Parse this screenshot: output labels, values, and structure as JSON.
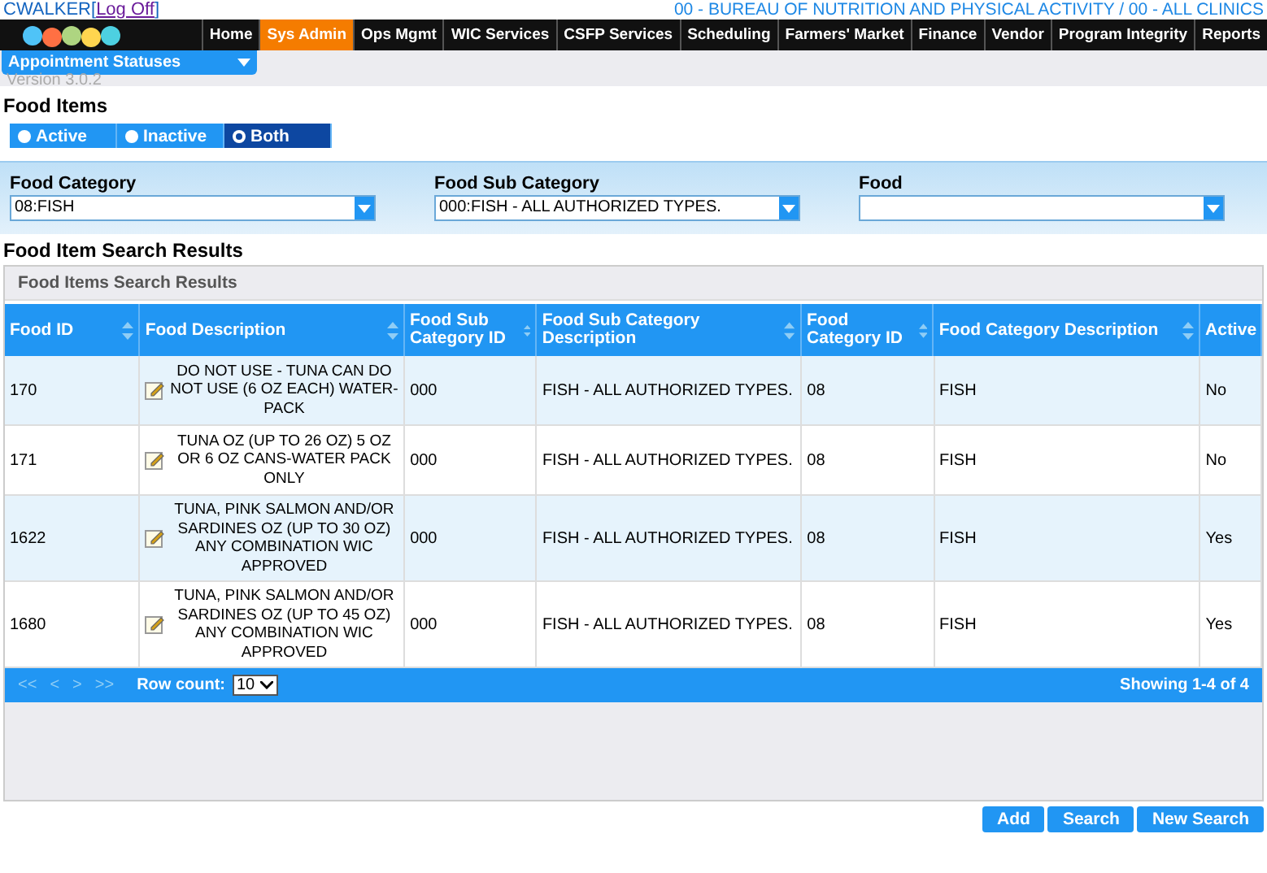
{
  "header": {
    "user": "CWALKER",
    "open_bracket": "[",
    "logoff": "Log Off",
    "close_bracket": "]",
    "agency": "00 - BUREAU OF NUTRITION AND PHYSICAL ACTIVITY / 00 - ALL CLINICS"
  },
  "nav": [
    {
      "label": "Home",
      "selected": false
    },
    {
      "label": "Sys Admin",
      "selected": true
    },
    {
      "label": "Ops Mgmt",
      "selected": false
    },
    {
      "label": "WIC Services",
      "selected": false
    },
    {
      "label": "CSFP Services",
      "selected": false
    },
    {
      "label": "Scheduling",
      "selected": false
    },
    {
      "label": "Farmers' Market",
      "selected": false
    },
    {
      "label": "Finance",
      "selected": false
    },
    {
      "label": "Vendor",
      "selected": false
    },
    {
      "label": "Program Integrity",
      "selected": false
    },
    {
      "label": "Reports",
      "selected": false
    }
  ],
  "menu": {
    "value": "Appointment Statuses"
  },
  "version": "Version 3.0.2",
  "page_title": "Food Items",
  "status_filter": [
    {
      "label": "Active",
      "selected": false
    },
    {
      "label": "Inactive",
      "selected": false
    },
    {
      "label": "Both",
      "selected": true
    }
  ],
  "filters": [
    {
      "label": "Food Category",
      "value": "08:FISH"
    },
    {
      "label": "Food Sub Category",
      "value": "000:FISH - ALL AUTHORIZED TYPES."
    },
    {
      "label": "Food"
    }
  ],
  "results_title": "Food Item Search Results",
  "grid": {
    "caption": "Food Items Search Results",
    "columns": [
      "Food ID",
      "Food Description",
      "Food Sub Category ID",
      "Food Sub Category Description",
      "Food Category ID",
      "Food Category Description",
      "Active"
    ],
    "rows": [
      {
        "cells": [
          "170",
          "DO NOT USE - TUNA CAN DO NOT USE (6 OZ EACH) WATER-PACK",
          "000",
          "FISH - ALL AUTHORIZED TYPES.",
          "08",
          "FISH",
          "No"
        ]
      },
      {
        "cells": [
          "171",
          "TUNA OZ (UP TO 26 OZ) 5 OZ OR 6 OZ CANS-WATER PACK ONLY",
          "000",
          "FISH - ALL AUTHORIZED TYPES.",
          "08",
          "FISH",
          "No"
        ]
      },
      {
        "cells": [
          "1622",
          "TUNA, PINK SALMON AND/OR SARDINES OZ (UP TO 30 OZ) ANY COMBINATION WIC APPROVED",
          "000",
          "FISH - ALL AUTHORIZED TYPES.",
          "08",
          "FISH",
          "Yes"
        ]
      },
      {
        "cells": [
          "1680",
          "TUNA, PINK SALMON AND/OR SARDINES OZ (UP TO 45 OZ) ANY COMBINATION WIC APPROVED",
          "000",
          "FISH - ALL AUTHORIZED TYPES.",
          "08",
          "FISH",
          "Yes"
        ]
      }
    ],
    "pager": {
      "first": "<<",
      "prev": "<",
      "next": ">",
      "last": ">>",
      "row_count_label": "Row count:",
      "row_count": "10",
      "showing": "Showing 1-4 of 4"
    }
  },
  "buttons": [
    "Add",
    "Search",
    "New Search"
  ]
}
